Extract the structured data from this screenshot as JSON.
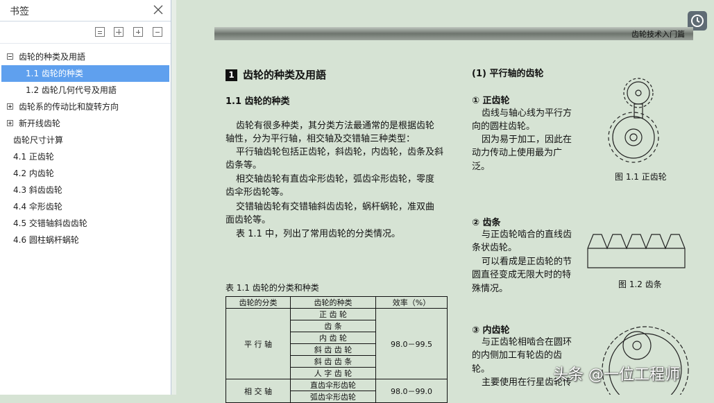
{
  "sidebar": {
    "title": "书签",
    "items": [
      {
        "label": "齿轮的种类及用語",
        "toggle": "minus"
      },
      {
        "label": "1.1 齿轮的种类",
        "selected": true
      },
      {
        "label": "1.2 齿轮几何代号及用語"
      },
      {
        "label": "齿轮系的传动比和旋转方向",
        "toggle": "plus"
      },
      {
        "label": "新开线齿轮",
        "toggle": "plus"
      },
      {
        "label": "齿轮尺寸计算"
      },
      {
        "label": "4.1 正齿轮"
      },
      {
        "label": "4.2 内齿轮"
      },
      {
        "label": "4.3 斜齿齿轮"
      },
      {
        "label": "4.4 伞形齿轮"
      },
      {
        "label": "4.5 交错轴斜齿齿轮"
      },
      {
        "label": "4.6 圆柱蜗杆蜗轮"
      }
    ]
  },
  "doc": {
    "banner": "齿轮技术入门篇",
    "chapter_no": "1",
    "chapter_title": "齿轮的种类及用語",
    "section_title": "1.1 齿轮的种类",
    "paragraphs": [
      "齿轮有很多种类，其分类方法最通常的是根据齿轮",
      "轴性，分为平行轴，相交轴及交错轴三种类型：",
      "平行轴齿轮包括正齿轮，斜齿轮，内齿轮，齿条及斜",
      "齿条等。",
      "相交轴齿轮有直齿伞形齿轮，弧齿伞形齿轮，零度",
      "齿伞形齿轮等。",
      "交错轴齿轮有交错轴斜齿齿轮，蜗杆蜗轮，准双曲",
      "面齿轮等。",
      "表 1.1 中，列出了常用齿轮的分类情况。"
    ],
    "table_caption": "表 1.1 齿轮的分类和种类",
    "table": {
      "headers": [
        "齿轮的分类",
        "齿轮的种类",
        "效率（%）"
      ],
      "group1": "平 行 轴",
      "group1_types": [
        "正 齿 轮",
        "齿 条",
        "内 齿 轮",
        "斜 齿 齿 轮",
        "斜 齿 齿 条",
        "人 字 齿 轮"
      ],
      "group1_eff": "98.0－99.5",
      "group2": "相 交 轴",
      "group2_types": [
        "直齿伞形齿轮",
        "弧齿伞形齿轮"
      ],
      "group2_eff": "98.0－99.0"
    },
    "right": {
      "heading": "(1) 平行轴的齿轮",
      "s1_title": "① 正齿轮",
      "s1_lines": [
        "齿线与轴心线为平行方",
        "向的圆柱齿轮。",
        "因为易于加工，因此在",
        "动力传动上使用最为广",
        "泛。"
      ],
      "fig1": "图 1.1 正齿轮",
      "s2_title": "② 齿条",
      "s2_lines": [
        "与正齿轮啮合的直线齿",
        "条状齿轮。",
        "可以看成是正齿轮的节",
        "圆直径变成无限大时的特",
        "殊情况。"
      ],
      "fig2": "图 1.2 齿条",
      "s3_title": "③ 内齿轮",
      "s3_lines": [
        "与正齿轮相啮合在圆环",
        "的内侧加工有轮齿的齿",
        "轮。",
        "主要使用在行星齿轮传"
      ]
    }
  },
  "watermark": "头条 @一位工程师"
}
